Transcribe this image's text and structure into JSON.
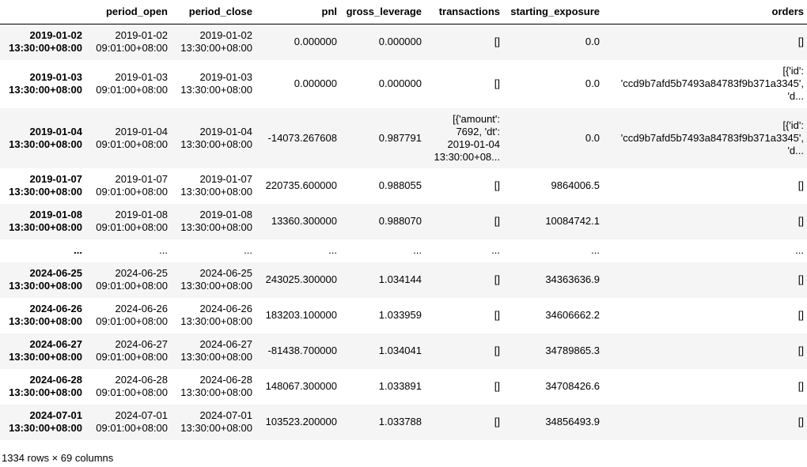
{
  "table": {
    "columns": [
      "",
      "period_open",
      "period_close",
      "pnl",
      "gross_leverage",
      "transactions",
      "starting_exposure",
      "orders"
    ],
    "rows": [
      {
        "index": [
          "2019-01-02",
          "13:30:00+08:00"
        ],
        "period_open": [
          "2019-01-02",
          "09:01:00+08:00"
        ],
        "period_close": [
          "2019-01-02",
          "13:30:00+08:00"
        ],
        "pnl": "0.000000",
        "gross_leverage": "0.000000",
        "transactions": [
          "[]"
        ],
        "starting_exposure": "0.0",
        "orders": [
          "[]"
        ],
        "height": 45
      },
      {
        "index": [
          "2019-01-03",
          "13:30:00+08:00"
        ],
        "period_open": [
          "2019-01-03",
          "09:01:00+08:00"
        ],
        "period_close": [
          "2019-01-03",
          "13:30:00+08:00"
        ],
        "pnl": "0.000000",
        "gross_leverage": "0.000000",
        "transactions": [
          "[]"
        ],
        "starting_exposure": "0.0",
        "orders": [
          "[{'id':",
          "'ccd9b7afd5b7493a84783f9b371a3345',",
          "'d..."
        ],
        "height": 61
      },
      {
        "index": [
          "2019-01-04",
          "13:30:00+08:00"
        ],
        "period_open": [
          "2019-01-04",
          "09:01:00+08:00"
        ],
        "period_close": [
          "2019-01-04",
          "13:30:00+08:00"
        ],
        "pnl": "-14073.267608",
        "gross_leverage": "0.987791",
        "transactions": [
          "[{'amount':",
          "7692, 'dt':",
          "2019-01-04",
          "13:30:00+08..."
        ],
        "starting_exposure": "0.0",
        "orders": [
          "[{'id':",
          "'ccd9b7afd5b7493a84783f9b371a3345',",
          "'d..."
        ],
        "height": 76
      },
      {
        "index": [
          "2019-01-07",
          "13:30:00+08:00"
        ],
        "period_open": [
          "2019-01-07",
          "09:01:00+08:00"
        ],
        "period_close": [
          "2019-01-07",
          "13:30:00+08:00"
        ],
        "pnl": "220735.600000",
        "gross_leverage": "0.988055",
        "transactions": [
          "[]"
        ],
        "starting_exposure": "9864006.5",
        "orders": [
          "[]"
        ],
        "height": 45
      },
      {
        "index": [
          "2019-01-08",
          "13:30:00+08:00"
        ],
        "period_open": [
          "2019-01-08",
          "09:01:00+08:00"
        ],
        "period_close": [
          "2019-01-08",
          "13:30:00+08:00"
        ],
        "pnl": "13360.300000",
        "gross_leverage": "0.988070",
        "transactions": [
          "[]"
        ],
        "starting_exposure": "10084742.1",
        "orders": [
          "[]"
        ],
        "height": 45
      },
      {
        "index": [
          "..."
        ],
        "period_open": [
          "..."
        ],
        "period_close": [
          "..."
        ],
        "pnl": "...",
        "gross_leverage": "...",
        "transactions": [
          "..."
        ],
        "starting_exposure": "...",
        "orders": [
          "..."
        ],
        "height": 29
      },
      {
        "index": [
          "2024-06-25",
          "13:30:00+08:00"
        ],
        "period_open": [
          "2024-06-25",
          "09:01:00+08:00"
        ],
        "period_close": [
          "2024-06-25",
          "13:30:00+08:00"
        ],
        "pnl": "243025.300000",
        "gross_leverage": "1.034144",
        "transactions": [
          "[]"
        ],
        "starting_exposure": "34363636.9",
        "orders": [
          "[]"
        ],
        "height": 45
      },
      {
        "index": [
          "2024-06-26",
          "13:30:00+08:00"
        ],
        "period_open": [
          "2024-06-26",
          "09:01:00+08:00"
        ],
        "period_close": [
          "2024-06-26",
          "13:30:00+08:00"
        ],
        "pnl": "183203.100000",
        "gross_leverage": "1.033959",
        "transactions": [
          "[]"
        ],
        "starting_exposure": "34606662.2",
        "orders": [
          "[]"
        ],
        "height": 45
      },
      {
        "index": [
          "2024-06-27",
          "13:30:00+08:00"
        ],
        "period_open": [
          "2024-06-27",
          "09:01:00+08:00"
        ],
        "period_close": [
          "2024-06-27",
          "13:30:00+08:00"
        ],
        "pnl": "-81438.700000",
        "gross_leverage": "1.034041",
        "transactions": [
          "[]"
        ],
        "starting_exposure": "34789865.3",
        "orders": [
          "[]"
        ],
        "height": 45
      },
      {
        "index": [
          "2024-06-28",
          "13:30:00+08:00"
        ],
        "period_open": [
          "2024-06-28",
          "09:01:00+08:00"
        ],
        "period_close": [
          "2024-06-28",
          "13:30:00+08:00"
        ],
        "pnl": "148067.300000",
        "gross_leverage": "1.033891",
        "transactions": [
          "[]"
        ],
        "starting_exposure": "34708426.6",
        "orders": [
          "[]"
        ],
        "height": 45
      },
      {
        "index": [
          "2024-07-01",
          "13:30:00+08:00"
        ],
        "period_open": [
          "2024-07-01",
          "09:01:00+08:00"
        ],
        "period_close": [
          "2024-07-01",
          "13:30:00+08:00"
        ],
        "pnl": "103523.200000",
        "gross_leverage": "1.033788",
        "transactions": [
          "[]"
        ],
        "starting_exposure": "34856493.9",
        "orders": [
          "[]"
        ],
        "height": 45
      }
    ]
  },
  "footer": {
    "shape_text": "1334 rows × 69 columns"
  }
}
